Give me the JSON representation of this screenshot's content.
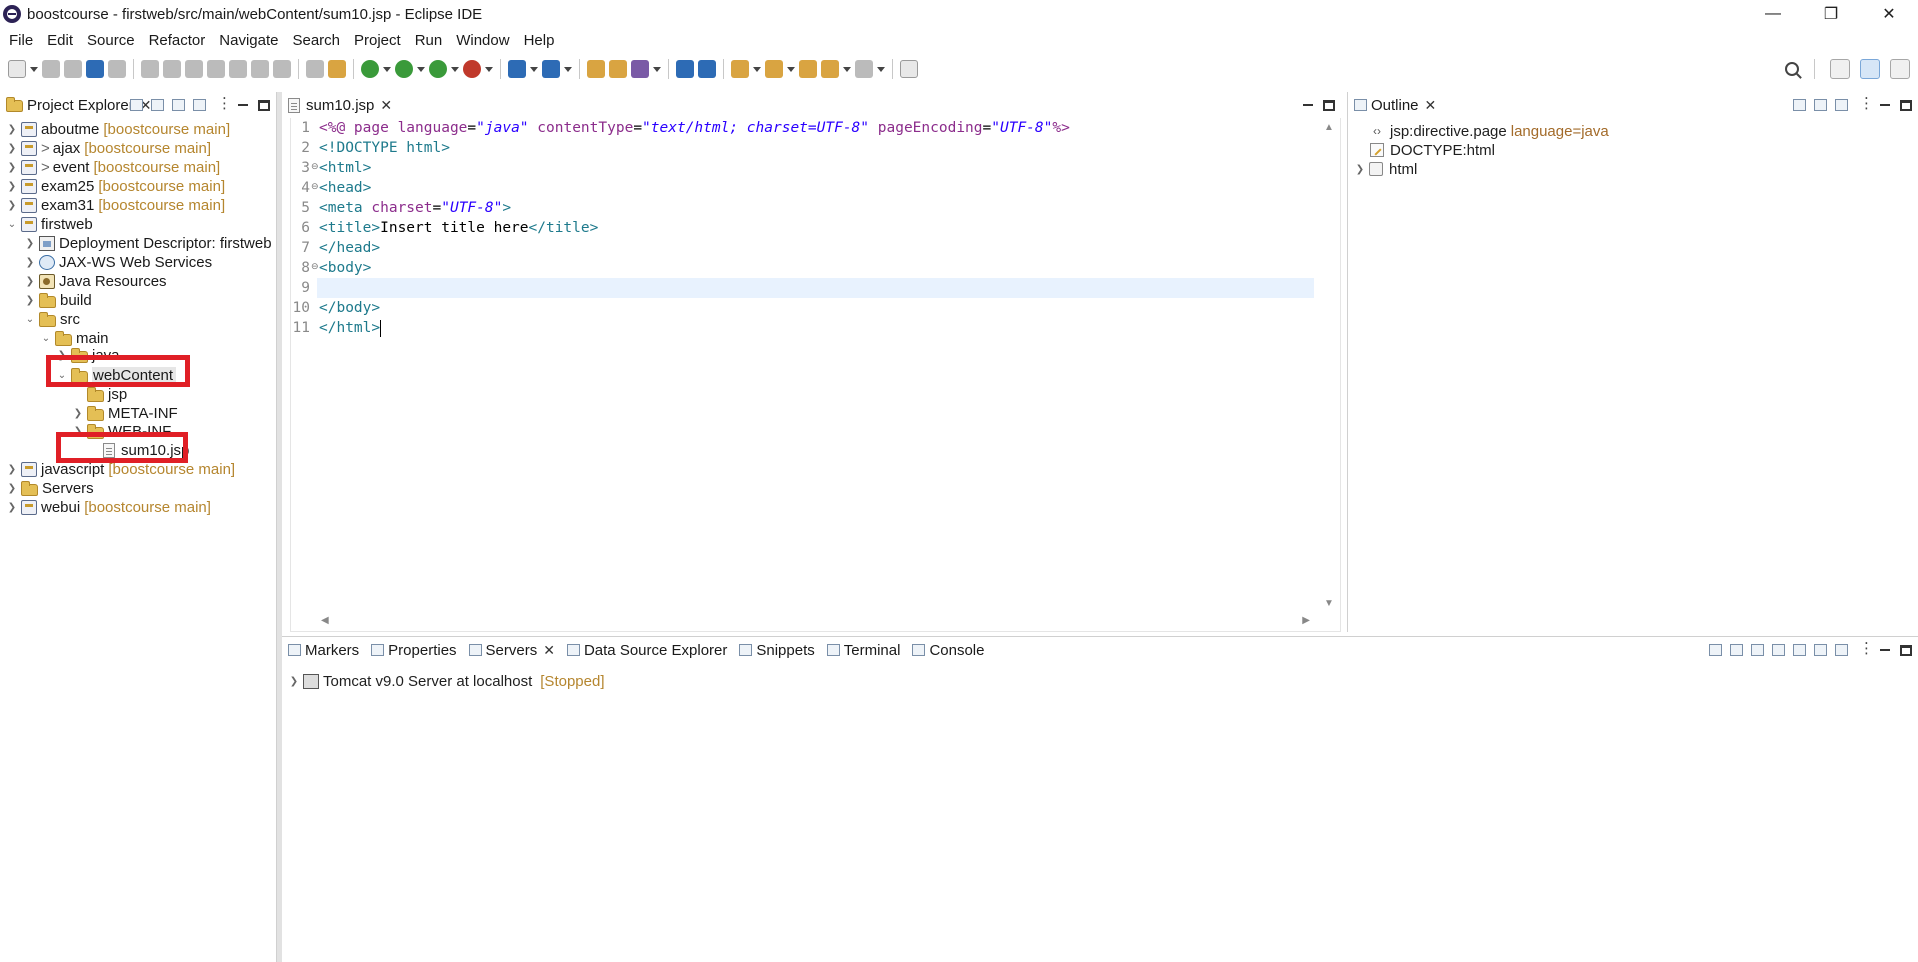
{
  "window": {
    "title": "boostcourse - firstweb/src/main/webContent/sum10.jsp - Eclipse IDE",
    "minimize": "—",
    "restore": "❐",
    "close": "✕"
  },
  "menu": [
    "File",
    "Edit",
    "Source",
    "Refactor",
    "Navigate",
    "Search",
    "Project",
    "Run",
    "Window",
    "Help"
  ],
  "explorer": {
    "tab_label": "Project Explorer",
    "nodes": [
      {
        "label": "aboutme",
        "decor": "[boostcourse main]",
        "prefix": ""
      },
      {
        "label": "ajax",
        "decor": "[boostcourse main]",
        "prefix": ">"
      },
      {
        "label": "event",
        "decor": "[boostcourse main]",
        "prefix": ">"
      },
      {
        "label": "exam25",
        "decor": "[boostcourse main]",
        "prefix": ""
      },
      {
        "label": "exam31",
        "decor": "[boostcourse main]",
        "prefix": ""
      },
      {
        "label": "firstweb",
        "decor": "",
        "prefix": ""
      },
      {
        "label": "Deployment Descriptor: firstweb",
        "decor": "",
        "prefix": ""
      },
      {
        "label": "JAX-WS Web Services",
        "decor": "",
        "prefix": ""
      },
      {
        "label": "Java Resources",
        "decor": "",
        "prefix": ""
      },
      {
        "label": "build",
        "decor": "",
        "prefix": ""
      },
      {
        "label": "src",
        "decor": "",
        "prefix": ""
      },
      {
        "label": "main",
        "decor": "",
        "prefix": ""
      },
      {
        "label": "java",
        "decor": "",
        "prefix": ""
      },
      {
        "label": "webContent",
        "decor": "",
        "prefix": ""
      },
      {
        "label": "jsp",
        "decor": "",
        "prefix": ""
      },
      {
        "label": "META-INF",
        "decor": "",
        "prefix": ""
      },
      {
        "label": "WEB-INF",
        "decor": "",
        "prefix": ""
      },
      {
        "label": "sum10.jsp",
        "decor": "",
        "prefix": ""
      },
      {
        "label": "javascript",
        "decor": "[boostcourse main]",
        "prefix": ""
      },
      {
        "label": "Servers",
        "decor": "",
        "prefix": ""
      },
      {
        "label": "webui",
        "decor": "[boostcourse main]",
        "prefix": ""
      }
    ]
  },
  "editor": {
    "tab_label": "sum10.jsp",
    "line_numbers": [
      "1",
      "2",
      "3",
      "4",
      "5",
      "6",
      "7",
      "8",
      "9",
      "10",
      "11"
    ],
    "lines": {
      "l1": {
        "open": "<%@ ",
        "kw": "page ",
        "a1": "language",
        "eq1": "=",
        "v1": "\"java\"",
        "a2": " contentType",
        "eq2": "=",
        "v2": "\"text/html; charset=UTF-8\"",
        "a3": " pageEncoding",
        "eq3": "=",
        "v3": "\"UTF-8\"",
        "close": "%>"
      },
      "l2": {
        "text": "<!DOCTYPE html>"
      },
      "l3": {
        "text": "<html>"
      },
      "l4": {
        "text": "<head>"
      },
      "l5": {
        "open": "<meta ",
        "a1": "charset",
        "eq1": "=",
        "v1": "\"UTF-8\"",
        "close": ">"
      },
      "l6": {
        "open": "<title>",
        "text": "Insert title here",
        "close": "</title>"
      },
      "l7": {
        "text": "</head>"
      },
      "l8": {
        "text": "<body>"
      },
      "l9": {
        "text": ""
      },
      "l10": {
        "text": "</body>"
      },
      "l11": {
        "text": "</html>"
      }
    }
  },
  "outline": {
    "tab_label": "Outline",
    "nodes": [
      {
        "label": "jsp:directive.page",
        "extra": "language=java"
      },
      {
        "label": "DOCTYPE:html",
        "extra": ""
      },
      {
        "label": "html",
        "extra": ""
      }
    ]
  },
  "bottom": {
    "tabs": [
      "Markers",
      "Properties",
      "Servers",
      "Data Source Explorer",
      "Snippets",
      "Terminal",
      "Console"
    ],
    "server": {
      "label": "Tomcat v9.0 Server at localhost",
      "state": "[Stopped]"
    }
  },
  "icons": {
    "accent": "#e01f26",
    "selection": "#5b9bd5"
  }
}
